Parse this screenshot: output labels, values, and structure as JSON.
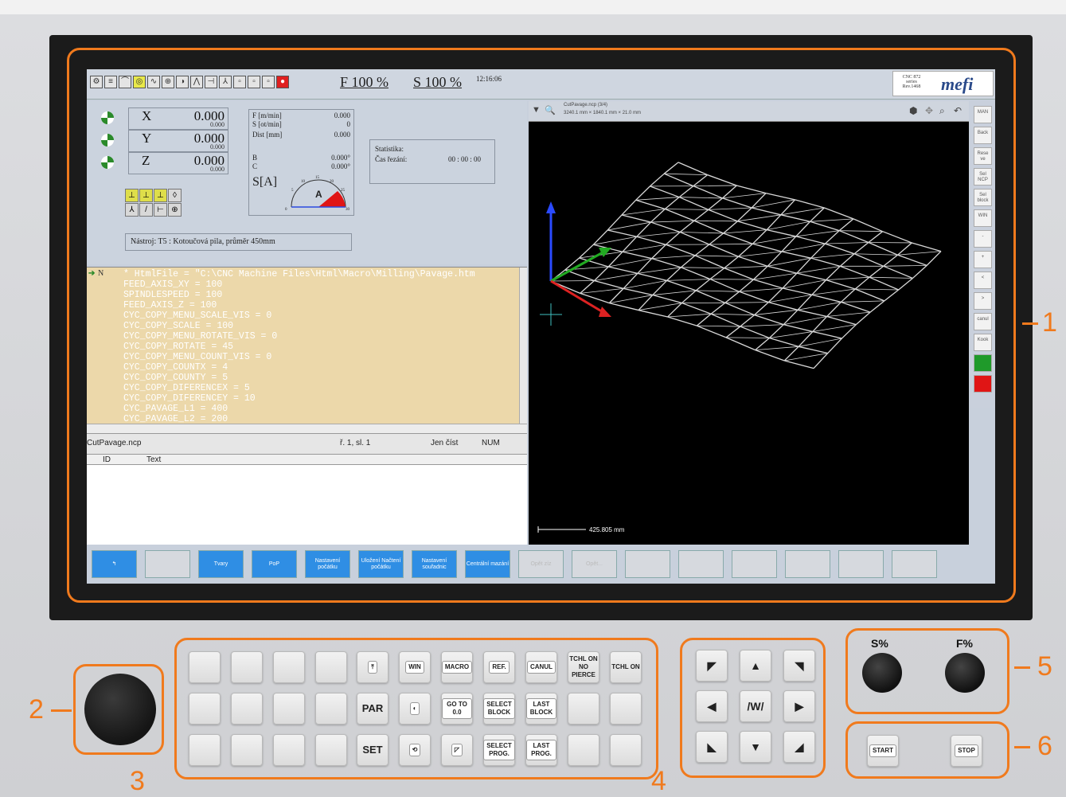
{
  "screen": {
    "feed_override": "F 100 %",
    "spindle_override": "S 100 %",
    "clock": "12:16:06",
    "brand_series": "CNC 872 series",
    "brand_sub": "Rev.1468",
    "brand_logo": "mefi",
    "axes": [
      {
        "name": "X",
        "value": "0.000",
        "sub": "0.000"
      },
      {
        "name": "Y",
        "value": "0.000",
        "sub": "0.000"
      },
      {
        "name": "Z",
        "value": "0.000",
        "sub": "0.000"
      }
    ],
    "feed": {
      "f_label": "F [m/min]",
      "f_value": "0.000",
      "s_label": "S [ot/min]",
      "s_value": "0",
      "dist_label": "Dist [mm]",
      "dist_value": "0.000",
      "b_label": "B",
      "b_value": "0.000°",
      "c_label": "C",
      "c_value": "0.000°",
      "sa_label": "S[A]",
      "gauge_letter": "A",
      "gauge_ticks": [
        "0",
        "5",
        "10",
        "15",
        "20",
        "25",
        "30"
      ],
      "gauge_level_fraction": 0.2
    },
    "stats": {
      "title": "Statistika:",
      "cut_label": "Čas řezání:",
      "cut_value": "00 : 00 : 00"
    },
    "tool": "Nástroj:  T5 :  Kotoučová pila, průměr 450mm",
    "code_lines": [
      "* HtmlFile = \"C:\\CNC Machine Files\\Html\\Macro\\Milling\\Pavage.htm",
      "FEED_AXIS_XY = 100",
      "SPINDLESPEED = 100",
      "FEED_AXIS_Z = 100",
      "CYC_COPY_MENU_SCALE_VIS = 0",
      "CYC_COPY_SCALE = 100",
      "CYC_COPY_MENU_ROTATE_VIS = 0",
      "CYC_COPY_ROTATE = 45",
      "CYC_COPY_MENU_COUNT_VIS = 0",
      "CYC_COPY_COUNTX = 4",
      "CYC_COPY_COUNTY = 5",
      "CYC_COPY_DIFERENCEX = 5",
      "CYC_COPY_DIFERENCEY = 10",
      "CYC_PAVAGE_L1 = 400",
      "CYC_PAVAGE_L2 = 200"
    ],
    "code_marker": "N",
    "status_file": "CutPavage.ncp",
    "status_pos": "ř. 1,  sl. 1",
    "status_mode": "Jen číst",
    "status_num": "NUM",
    "msg_cols": [
      "ID",
      "Text"
    ],
    "view_title": "CutPavage.ncp (3/4)",
    "view_dims": "3240.1 mm × 1840.1 mm × 21.0 mm",
    "view_scale": "425.805 mm",
    "side_buttons": [
      "MAN",
      "Back",
      "Rese ve",
      "Sel NCP",
      "Sel block",
      "WIN",
      "-",
      "+",
      "<",
      ">",
      "canul",
      "Kook",
      "",
      ""
    ],
    "side_colors": {
      "green": "#1f9a2a",
      "red": "#e01515"
    },
    "fn_buttons": [
      {
        "label": "↰",
        "style": "blue"
      },
      {
        "label": "",
        "style": "grey"
      },
      {
        "label": "Tvary",
        "style": "blue"
      },
      {
        "label": "PoP",
        "style": "blue"
      },
      {
        "label": "Nastavení počátku",
        "style": "blue"
      },
      {
        "label": "Uložení Načtení počátku",
        "style": "blue"
      },
      {
        "label": "Nastavení souřadnic",
        "style": "blue"
      },
      {
        "label": "Centrální mazání",
        "style": "blue"
      },
      {
        "label": "Opět zíz",
        "style": "grey"
      },
      {
        "label": "Opět...",
        "style": "grey"
      },
      {
        "label": "",
        "style": "grey"
      },
      {
        "label": "",
        "style": "grey"
      },
      {
        "label": "",
        "style": "grey"
      },
      {
        "label": "",
        "style": "grey"
      },
      {
        "label": "",
        "style": "grey"
      },
      {
        "label": "",
        "style": "grey"
      }
    ]
  },
  "keypad": {
    "row1": [
      "",
      "",
      "",
      "",
      "⤒",
      "WIN",
      "MACRO",
      "REF.",
      "CANUL",
      "TCHL ON NO PIERCE",
      "TCHL ON"
    ],
    "row2": [
      "",
      "",
      "",
      "",
      "PAR",
      "◐",
      "GO TO 0.0",
      "SELECT BLOCK",
      "LAST BLOCK",
      "",
      ""
    ],
    "row3": [
      "",
      "",
      "",
      "",
      "SET",
      "⟲",
      "◸",
      "SELECT PROG.",
      "LAST PROG.",
      "",
      ""
    ]
  },
  "jog": [
    "◤",
    "▲",
    "◥",
    "◀",
    "/W/",
    "▶",
    "◣",
    "▼",
    "◢"
  ],
  "knobs": {
    "s_label": "S%",
    "f_label": "F%"
  },
  "buttons": {
    "start": "START",
    "stop": "STOP"
  },
  "callouts": {
    "c1": "1",
    "c2": "2",
    "c3": "3",
    "c4": "4",
    "c5": "5",
    "c6": "6"
  },
  "colors": {
    "accent": "#f07a1d",
    "code_bg": "#ecd8aa",
    "screen_bg": "#c8d0dc"
  }
}
